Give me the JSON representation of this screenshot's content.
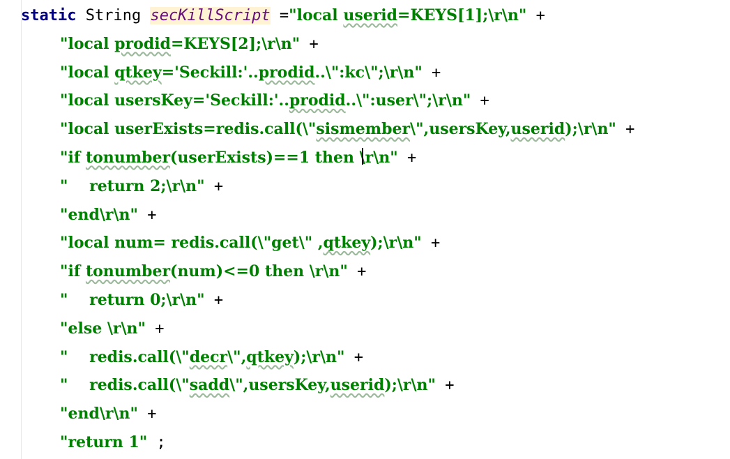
{
  "editor": {
    "lines": [
      {
        "tokens": [
          {
            "t": "static",
            "c": "kw"
          },
          {
            "t": " ",
            "c": "op"
          },
          {
            "t": "String",
            "c": "type"
          },
          {
            "t": " ",
            "c": "op"
          },
          {
            "t": "secKillScript",
            "c": "field"
          },
          {
            "t": " =",
            "c": "op"
          },
          {
            "t": "\"local ",
            "c": "str"
          },
          {
            "t": "userid",
            "c": "str typo"
          },
          {
            "t": "=KEYS[1];\\r\\n\"",
            "c": "str"
          },
          {
            "t": " +",
            "c": "plus"
          }
        ]
      },
      {
        "tokens": [
          {
            "t": "\"local ",
            "c": "str"
          },
          {
            "t": "prodid",
            "c": "str typo"
          },
          {
            "t": "=KEYS[2];\\r\\n\"",
            "c": "str"
          },
          {
            "t": " +",
            "c": "plus"
          }
        ]
      },
      {
        "tokens": [
          {
            "t": "\"local ",
            "c": "str"
          },
          {
            "t": "qtkey",
            "c": "str typo"
          },
          {
            "t": "='Seckill:'..",
            "c": "str"
          },
          {
            "t": "prodid",
            "c": "str typo"
          },
          {
            "t": "..\\\":kc\\\";\\r\\n\"",
            "c": "str"
          },
          {
            "t": " +",
            "c": "plus"
          }
        ]
      },
      {
        "tokens": [
          {
            "t": "\"local usersKey='Seckill:'..",
            "c": "str"
          },
          {
            "t": "prodid",
            "c": "str typo"
          },
          {
            "t": "..\\\":user\\\";\\r\\n\"",
            "c": "str"
          },
          {
            "t": " +",
            "c": "plus"
          }
        ]
      },
      {
        "tokens": [
          {
            "t": "\"local userExists=redis.call(\\\"",
            "c": "str"
          },
          {
            "t": "sismember",
            "c": "str typo"
          },
          {
            "t": "\\\",usersKey,",
            "c": "str"
          },
          {
            "t": "userid",
            "c": "str typo"
          },
          {
            "t": ");\\r\\n\"",
            "c": "str"
          },
          {
            "t": " +",
            "c": "plus"
          }
        ]
      },
      {
        "tokens": [
          {
            "t": "\"if ",
            "c": "str"
          },
          {
            "t": "tonumber",
            "c": "str typo"
          },
          {
            "t": "(userExists)==1 then \\r\\n\"",
            "c": "str"
          },
          {
            "t": " +",
            "c": "plus"
          }
        ]
      },
      {
        "tokens": [
          {
            "t": "\"    return 2;\\r\\n\"",
            "c": "str"
          },
          {
            "t": " +",
            "c": "plus"
          }
        ]
      },
      {
        "tokens": [
          {
            "t": "\"end\\r\\n\"",
            "c": "str"
          },
          {
            "t": " +",
            "c": "plus"
          }
        ]
      },
      {
        "tokens": [
          {
            "t": "\"local num= redis.call(\\\"get\\\" ,",
            "c": "str"
          },
          {
            "t": "qtkey",
            "c": "str typo"
          },
          {
            "t": ");\\r\\n\"",
            "c": "str"
          },
          {
            "t": " +",
            "c": "plus"
          }
        ]
      },
      {
        "tokens": [
          {
            "t": "\"if ",
            "c": "str"
          },
          {
            "t": "tonumber",
            "c": "str typo"
          },
          {
            "t": "(num)<=0 then \\r\\n\"",
            "c": "str"
          },
          {
            "t": " +",
            "c": "plus"
          }
        ]
      },
      {
        "tokens": [
          {
            "t": "\"    return 0;\\r\\n\"",
            "c": "str"
          },
          {
            "t": " +",
            "c": "plus"
          }
        ]
      },
      {
        "tokens": [
          {
            "t": "\"else \\r\\n\"",
            "c": "str"
          },
          {
            "t": " +",
            "c": "plus"
          }
        ]
      },
      {
        "tokens": [
          {
            "t": "\"    redis.call(\\\"",
            "c": "str"
          },
          {
            "t": "decr",
            "c": "str typo"
          },
          {
            "t": "\\\",",
            "c": "str"
          },
          {
            "t": "qtkey",
            "c": "str typo"
          },
          {
            "t": ");\\r\\n\"",
            "c": "str"
          },
          {
            "t": " +",
            "c": "plus"
          }
        ]
      },
      {
        "tokens": [
          {
            "t": "\"    redis.call(\\\"",
            "c": "str"
          },
          {
            "t": "sadd",
            "c": "str typo"
          },
          {
            "t": "\\\",usersKey,",
            "c": "str"
          },
          {
            "t": "userid",
            "c": "str typo"
          },
          {
            "t": ");\\r\\n\"",
            "c": "str"
          },
          {
            "t": " +",
            "c": "plus"
          }
        ]
      },
      {
        "tokens": [
          {
            "t": "\"end\\r\\n\"",
            "c": "str"
          },
          {
            "t": " +",
            "c": "plus"
          }
        ]
      },
      {
        "tokens": [
          {
            "t": "\"return 1\"",
            "c": "str"
          },
          {
            "t": " ;",
            "c": "plus"
          }
        ]
      }
    ]
  },
  "colors": {
    "string": "#008000",
    "keyword": "#000080",
    "field": "#660e7a",
    "field_highlight": "#fff3d4",
    "background": "#ffffff"
  }
}
